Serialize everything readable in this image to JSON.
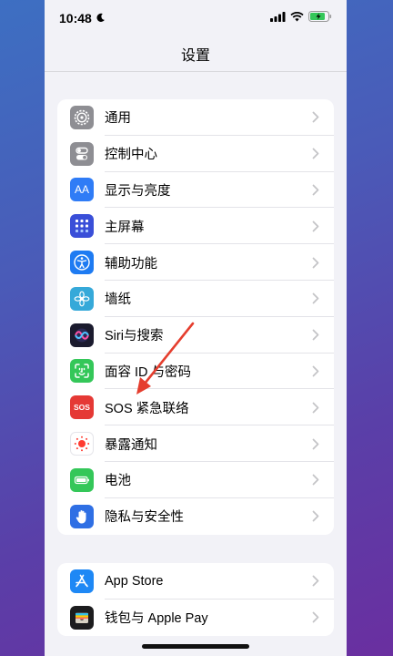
{
  "status_bar": {
    "time": "10:48"
  },
  "nav": {
    "title": "设置"
  },
  "group1": [
    {
      "label": "通用",
      "icon": "gear-icon",
      "color": "#8e8e93"
    },
    {
      "label": "控制中心",
      "icon": "toggles-icon",
      "color": "#8e8e93"
    },
    {
      "label": "显示与亮度",
      "icon": "text-size-icon",
      "color": "#2f7cf6",
      "icon_text": "AA"
    },
    {
      "label": "主屏幕",
      "icon": "home-grid-icon",
      "color": "#3a4fd8"
    },
    {
      "label": "辅助功能",
      "icon": "accessibility-icon",
      "color": "#1e7bf2"
    },
    {
      "label": "墙纸",
      "icon": "flower-icon",
      "color": "#36a9d9"
    },
    {
      "label": "Siri与搜索",
      "icon": "siri-icon",
      "color": "#1b1b2e"
    },
    {
      "label": "面容 ID 与密码",
      "icon": "face-id-icon",
      "color": "#34c759"
    },
    {
      "label": "SOS 紧急联络",
      "icon": "sos-icon",
      "color": "#e53935",
      "icon_text": "SOS"
    },
    {
      "label": "暴露通知",
      "icon": "exposure-icon",
      "color": "#ffffff"
    },
    {
      "label": "电池",
      "icon": "battery-icon",
      "color": "#34c759"
    },
    {
      "label": "隐私与安全性",
      "icon": "hand-icon",
      "color": "#2f6fe4"
    }
  ],
  "group2": [
    {
      "label": "App Store",
      "icon": "app-store-icon",
      "color": "#1e88f5"
    },
    {
      "label": "钱包与 Apple Pay",
      "icon": "wallet-icon",
      "color": "#1c1c1e"
    }
  ]
}
